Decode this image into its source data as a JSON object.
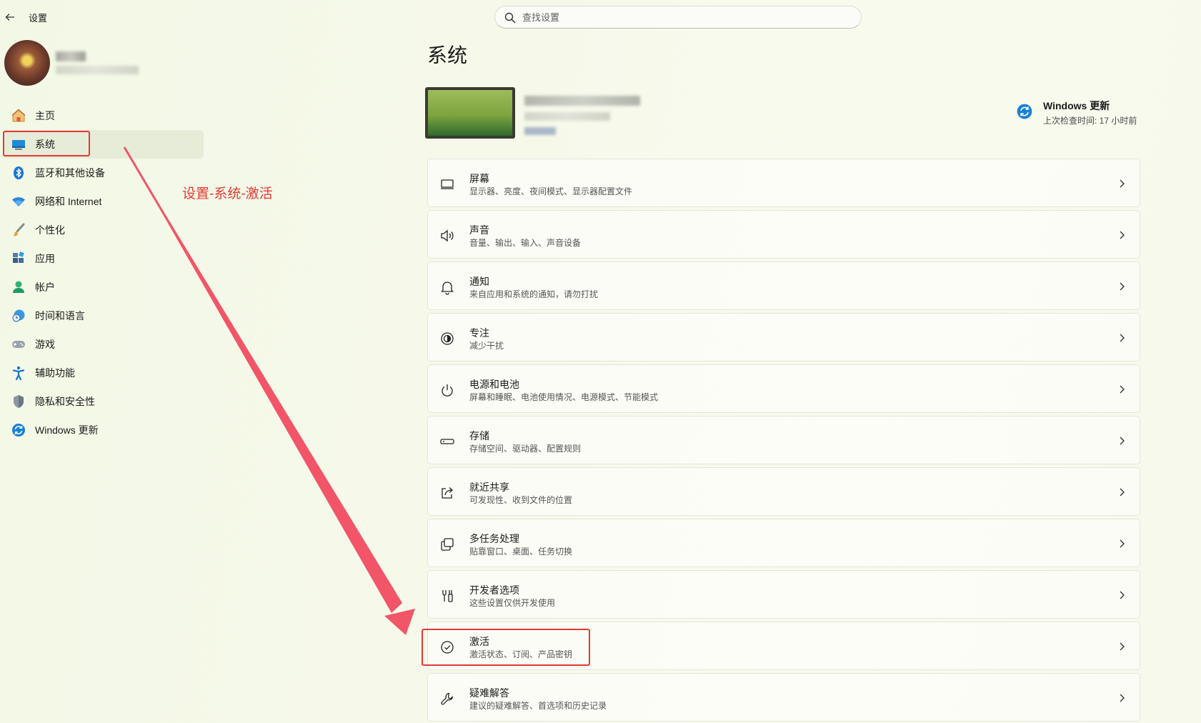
{
  "window": {
    "title": "设置"
  },
  "search": {
    "placeholder": "查找设置"
  },
  "profile": {
    "name": "",
    "email": ""
  },
  "sidebar": {
    "items": [
      {
        "label": "主页",
        "icon": "home-icon"
      },
      {
        "label": "系统",
        "icon": "system-icon",
        "active": true
      },
      {
        "label": "蓝牙和其他设备",
        "icon": "bluetooth-icon"
      },
      {
        "label": "网络和 Internet",
        "icon": "wifi-icon"
      },
      {
        "label": "个性化",
        "icon": "brush-icon"
      },
      {
        "label": "应用",
        "icon": "apps-icon"
      },
      {
        "label": "帐户",
        "icon": "account-icon"
      },
      {
        "label": "时间和语言",
        "icon": "time-language-icon"
      },
      {
        "label": "游戏",
        "icon": "gamepad-icon"
      },
      {
        "label": "辅助功能",
        "icon": "accessibility-icon"
      },
      {
        "label": "隐私和安全性",
        "icon": "shield-icon"
      },
      {
        "label": "Windows 更新",
        "icon": "windows-update-icon"
      }
    ]
  },
  "annotation": {
    "text": "设置-系统-激活",
    "color": "#e53935"
  },
  "main": {
    "title": "系统",
    "update": {
      "title": "Windows 更新",
      "subtitle": "上次检查时间: 17 小时前"
    },
    "cards": [
      {
        "title": "屏幕",
        "desc": "显示器、亮度、夜间模式、显示器配置文件",
        "icon": "display-icon"
      },
      {
        "title": "声音",
        "desc": "音量、输出、输入、声音设备",
        "icon": "speaker-icon"
      },
      {
        "title": "通知",
        "desc": "来自应用和系统的通知，请勿打扰",
        "icon": "bell-icon"
      },
      {
        "title": "专注",
        "desc": "减少干扰",
        "icon": "focus-icon"
      },
      {
        "title": "电源和电池",
        "desc": "屏幕和睡眠、电池使用情况、电源模式、节能模式",
        "icon": "power-icon"
      },
      {
        "title": "存储",
        "desc": "存储空间、驱动器、配置规则",
        "icon": "storage-icon"
      },
      {
        "title": "就近共享",
        "desc": "可发现性、收到文件的位置",
        "icon": "share-icon"
      },
      {
        "title": "多任务处理",
        "desc": "贴靠窗口、桌面、任务切换",
        "icon": "multitask-icon"
      },
      {
        "title": "开发者选项",
        "desc": "这些设置仅供开发使用",
        "icon": "developer-icon"
      },
      {
        "title": "激活",
        "desc": "激活状态、订阅、产品密钥",
        "icon": "activation-check-icon"
      },
      {
        "title": "疑难解答",
        "desc": "建议的疑难解答、首选项和历史记录",
        "icon": "wrench-icon"
      }
    ]
  },
  "colors": {
    "accent": "#0067c0",
    "highlight": "#e53935",
    "background": "#f5f9e9"
  }
}
